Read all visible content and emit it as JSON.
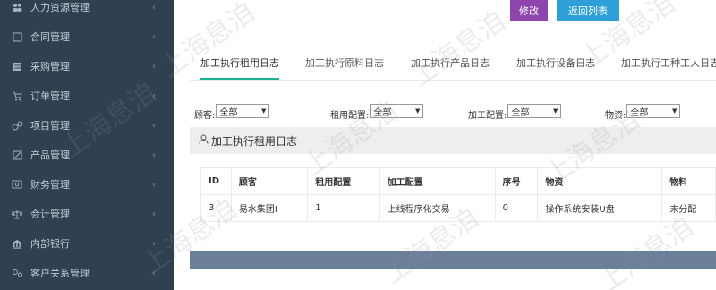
{
  "sidebar": {
    "items": [
      {
        "label": "人力资源管理",
        "icon": "people-icon"
      },
      {
        "label": "合同管理",
        "icon": "contract-icon"
      },
      {
        "label": "采购管理",
        "icon": "purchase-icon"
      },
      {
        "label": "订单管理",
        "icon": "cart-icon"
      },
      {
        "label": "项目管理",
        "icon": "project-icon"
      },
      {
        "label": "产品管理",
        "icon": "product-icon"
      },
      {
        "label": "财务管理",
        "icon": "finance-icon"
      },
      {
        "label": "会计管理",
        "icon": "accounting-icon"
      },
      {
        "label": "内部银行",
        "icon": "bank-icon"
      },
      {
        "label": "客户关系管理",
        "icon": "crm-icon"
      }
    ],
    "arrow": "‹"
  },
  "toolbar": {
    "edit_label": "修改",
    "back_label": "返回列表"
  },
  "tabs": [
    {
      "label": "加工执行租用日志",
      "active": true
    },
    {
      "label": "加工执行原料日志",
      "active": false
    },
    {
      "label": "加工执行产品日志",
      "active": false
    },
    {
      "label": "加工执行设备日志",
      "active": false
    },
    {
      "label": "加工执行工种工人日志",
      "active": false
    }
  ],
  "filters": [
    {
      "label": "顾客:",
      "value": "全部"
    },
    {
      "label": "租用配置:",
      "value": "全部"
    },
    {
      "label": "加工配置:",
      "value": "全部"
    },
    {
      "label": "物资:",
      "value": "全部"
    }
  ],
  "panel": {
    "title": "加工执行租用日志"
  },
  "table": {
    "headers": [
      "ID",
      "顾客",
      "租用配置",
      "加工配置",
      "序号",
      "物资",
      "物料"
    ],
    "rows": [
      [
        "3",
        "易水集团I",
        "1",
        "上线程序化交易",
        "0",
        "操作系统安装U盘",
        "未分配"
      ]
    ]
  },
  "watermark": "上海息洎"
}
